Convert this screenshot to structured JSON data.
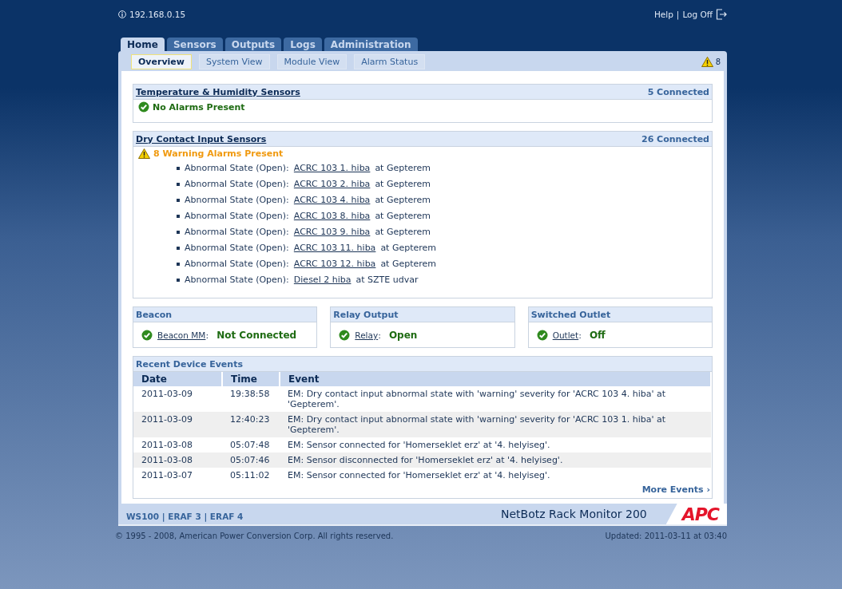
{
  "header": {
    "address": "192.168.0.15",
    "links": [
      "Help",
      "Log Off"
    ],
    "separator": "|"
  },
  "tabs": [
    {
      "label": "Home",
      "selected": true
    },
    {
      "label": "Sensors",
      "selected": false
    },
    {
      "label": "Outputs",
      "selected": false
    },
    {
      "label": "Logs",
      "selected": false
    },
    {
      "label": "Administration",
      "selected": false
    }
  ],
  "subtabs": [
    {
      "label": "Overview",
      "selected": true
    },
    {
      "label": "System View",
      "selected": false
    },
    {
      "label": "Module View",
      "selected": false
    },
    {
      "label": "Alarm Status",
      "selected": false
    }
  ],
  "alarm_count": "8",
  "sensor_groups": [
    {
      "title": "Temperature & Humidity Sensors",
      "count": "5 Connected",
      "status": {
        "kind": "ok",
        "text": "No Alarms Present"
      }
    },
    {
      "title": "Dry Contact Input Sensors",
      "count": "26 Connected",
      "status": {
        "kind": "warning",
        "text": "8 Warning Alarms Present"
      },
      "items": [
        {
          "prefix": "Abnormal State (Open):",
          "link": "ACRC 103 1. hiba",
          "suffix": "at Gepterem"
        },
        {
          "prefix": "Abnormal State (Open):",
          "link": "ACRC 103 2. hiba",
          "suffix": "at Gepterem"
        },
        {
          "prefix": "Abnormal State (Open):",
          "link": "ACRC 103 4. hiba",
          "suffix": "at Gepterem"
        },
        {
          "prefix": "Abnormal State (Open):",
          "link": "ACRC 103 8. hiba",
          "suffix": "at Gepterem"
        },
        {
          "prefix": "Abnormal State (Open):",
          "link": "ACRC 103 9. hiba",
          "suffix": "at Gepterem"
        },
        {
          "prefix": "Abnormal State (Open):",
          "link": "ACRC 103 11. hiba",
          "suffix": "at Gepterem"
        },
        {
          "prefix": "Abnormal State (Open):",
          "link": "ACRC 103 12. hiba",
          "suffix": "at Gepterem"
        },
        {
          "prefix": "Abnormal State (Open):",
          "link": "Diesel 2 hiba",
          "suffix": "at SZTE udvar"
        }
      ]
    }
  ],
  "outputs": [
    {
      "title": "Beacon",
      "link": "Beacon MM",
      "colon": ":",
      "value": "Not Connected",
      "kind": "ok"
    },
    {
      "title": "Relay Output",
      "link": "Relay",
      "colon": ":",
      "value": "Open",
      "kind": "ok"
    },
    {
      "title": "Switched Outlet",
      "link": "Outlet",
      "colon": ":",
      "value": "Off",
      "kind": "ok"
    }
  ],
  "events": {
    "title": "Recent Device Events",
    "columns": [
      "Date",
      "Time",
      "Event"
    ],
    "rows": [
      [
        "2011-03-09",
        "19:38:58",
        "EM: Dry contact input abnormal state with 'warning' severity for 'ACRC 103 4. hiba' at 'Gepterem'."
      ],
      [
        "2011-03-09",
        "12:40:23",
        "EM: Dry contact input abnormal state with 'warning' severity for 'ACRC 103 1. hiba' at 'Gepterem'."
      ],
      [
        "2011-03-08",
        "05:07:48",
        "EM: Sensor connected for 'Homerseklet erz' at '4. helyiseg'."
      ],
      [
        "2011-03-08",
        "05:07:46",
        "EM: Sensor disconnected for 'Homerseklet erz' at '4. helyiseg'."
      ],
      [
        "2011-03-07",
        "05:11:02",
        "EM: Sensor connected for 'Homerseklet erz' at '4. helyiseg'."
      ]
    ],
    "more": "More Events ›"
  },
  "footer": {
    "devices": "WS100 | ERAF 3 | ERAF 4",
    "product": "NetBotz Rack Monitor 200",
    "logo": "APC"
  },
  "copyright": "© 1995 - 2008, American Power Conversion Corp. All rights reserved.",
  "updated": "Updated: 2011-03-11 at 03:40"
}
